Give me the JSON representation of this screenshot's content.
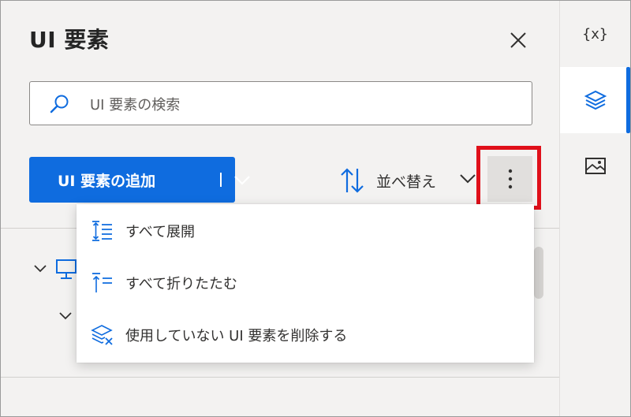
{
  "panel": {
    "title": "UI 要素",
    "search_placeholder": "UI 要素の検索",
    "add_button_label": "UI 要素の追加",
    "sort_label": "並べ替え"
  },
  "menu": {
    "items": [
      {
        "label": "すべて展開",
        "icon": "expand-all-icon"
      },
      {
        "label": "すべて折りたたむ",
        "icon": "collapse-all-icon"
      },
      {
        "label": "使用していない UI 要素を削除する",
        "icon": "remove-unused-icon"
      }
    ]
  },
  "rail": {
    "variables_label": "{x}",
    "items": [
      "variables",
      "ui-elements",
      "images"
    ],
    "active": "ui-elements"
  },
  "colors": {
    "accent": "#0f6cdf",
    "highlight": "#e0101a"
  }
}
